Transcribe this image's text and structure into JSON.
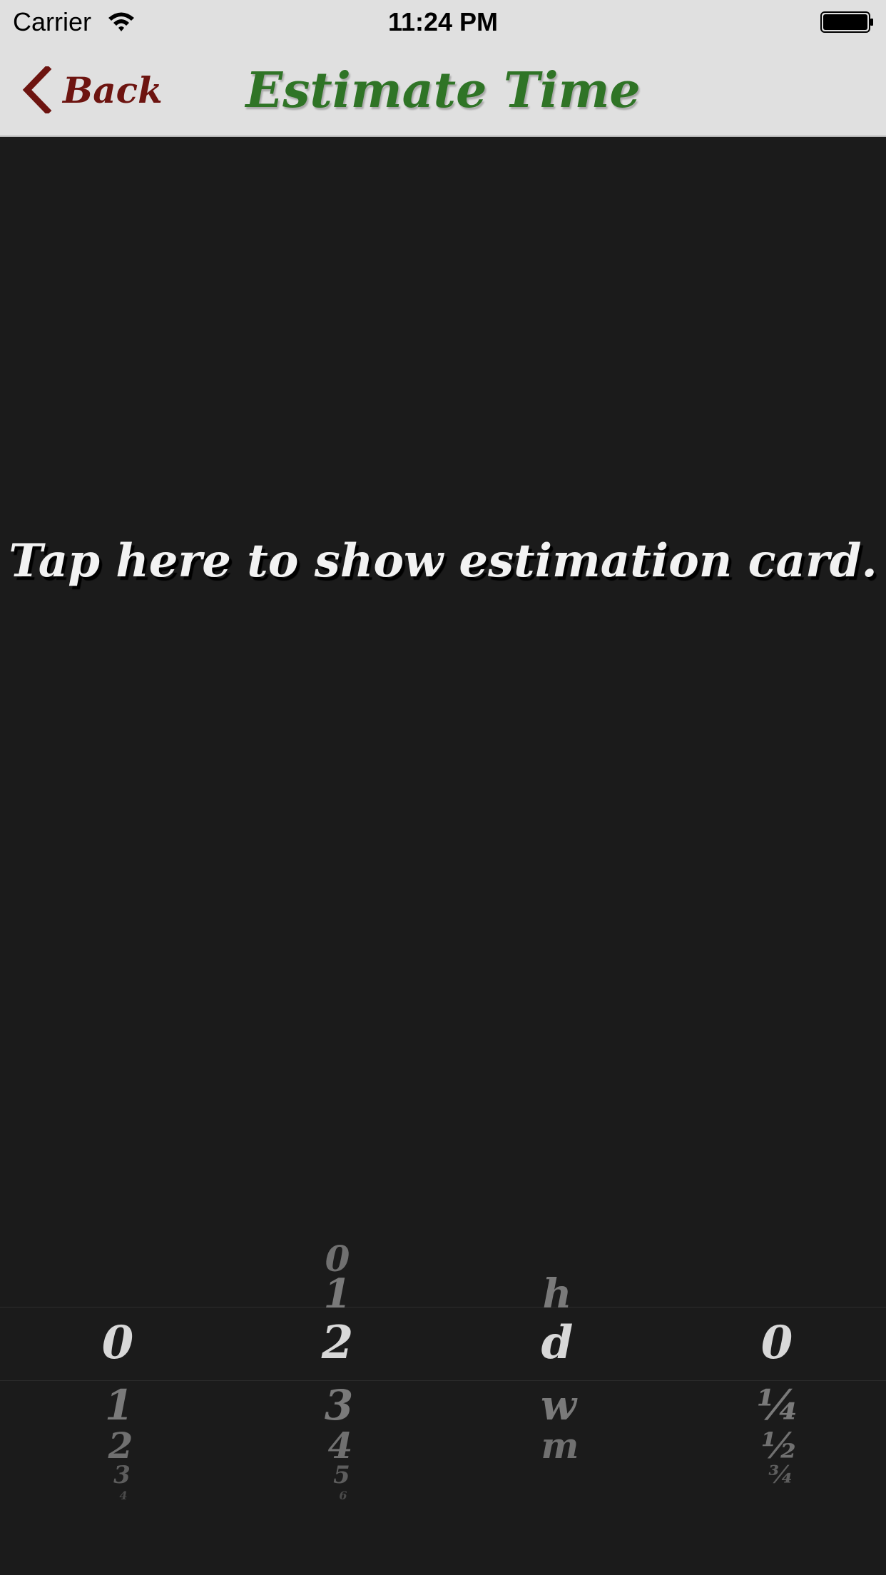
{
  "status_bar": {
    "carrier": "Carrier",
    "time": "11:24 PM",
    "wifi_icon": "wifi-icon",
    "battery_icon": "battery-full-icon"
  },
  "nav": {
    "back_label": "Back",
    "back_icon": "chevron-left-icon",
    "title": "Estimate Time"
  },
  "main": {
    "tap_hint": "Tap here to show estimation card."
  },
  "picker": {
    "columns": [
      {
        "name": "count",
        "values": [
          "0",
          "1",
          "2",
          "3",
          "4"
        ],
        "selected": "0"
      },
      {
        "name": "number",
        "values": [
          "0",
          "1",
          "2",
          "3",
          "4",
          "5",
          "6"
        ],
        "selected": "2"
      },
      {
        "name": "unit",
        "values": [
          "h",
          "d",
          "w",
          "m"
        ],
        "selected": "d"
      },
      {
        "name": "fraction",
        "values": [
          "0",
          "¼",
          "½",
          "¾"
        ],
        "selected": "0"
      }
    ]
  },
  "colors": {
    "nav_background": "#e0e0e0",
    "title_green": "#2f7426",
    "back_red": "#6d1410",
    "body_background": "#1b1b1b",
    "hint_text": "#f2f2f2",
    "picker_text": "#d8d8d8"
  }
}
